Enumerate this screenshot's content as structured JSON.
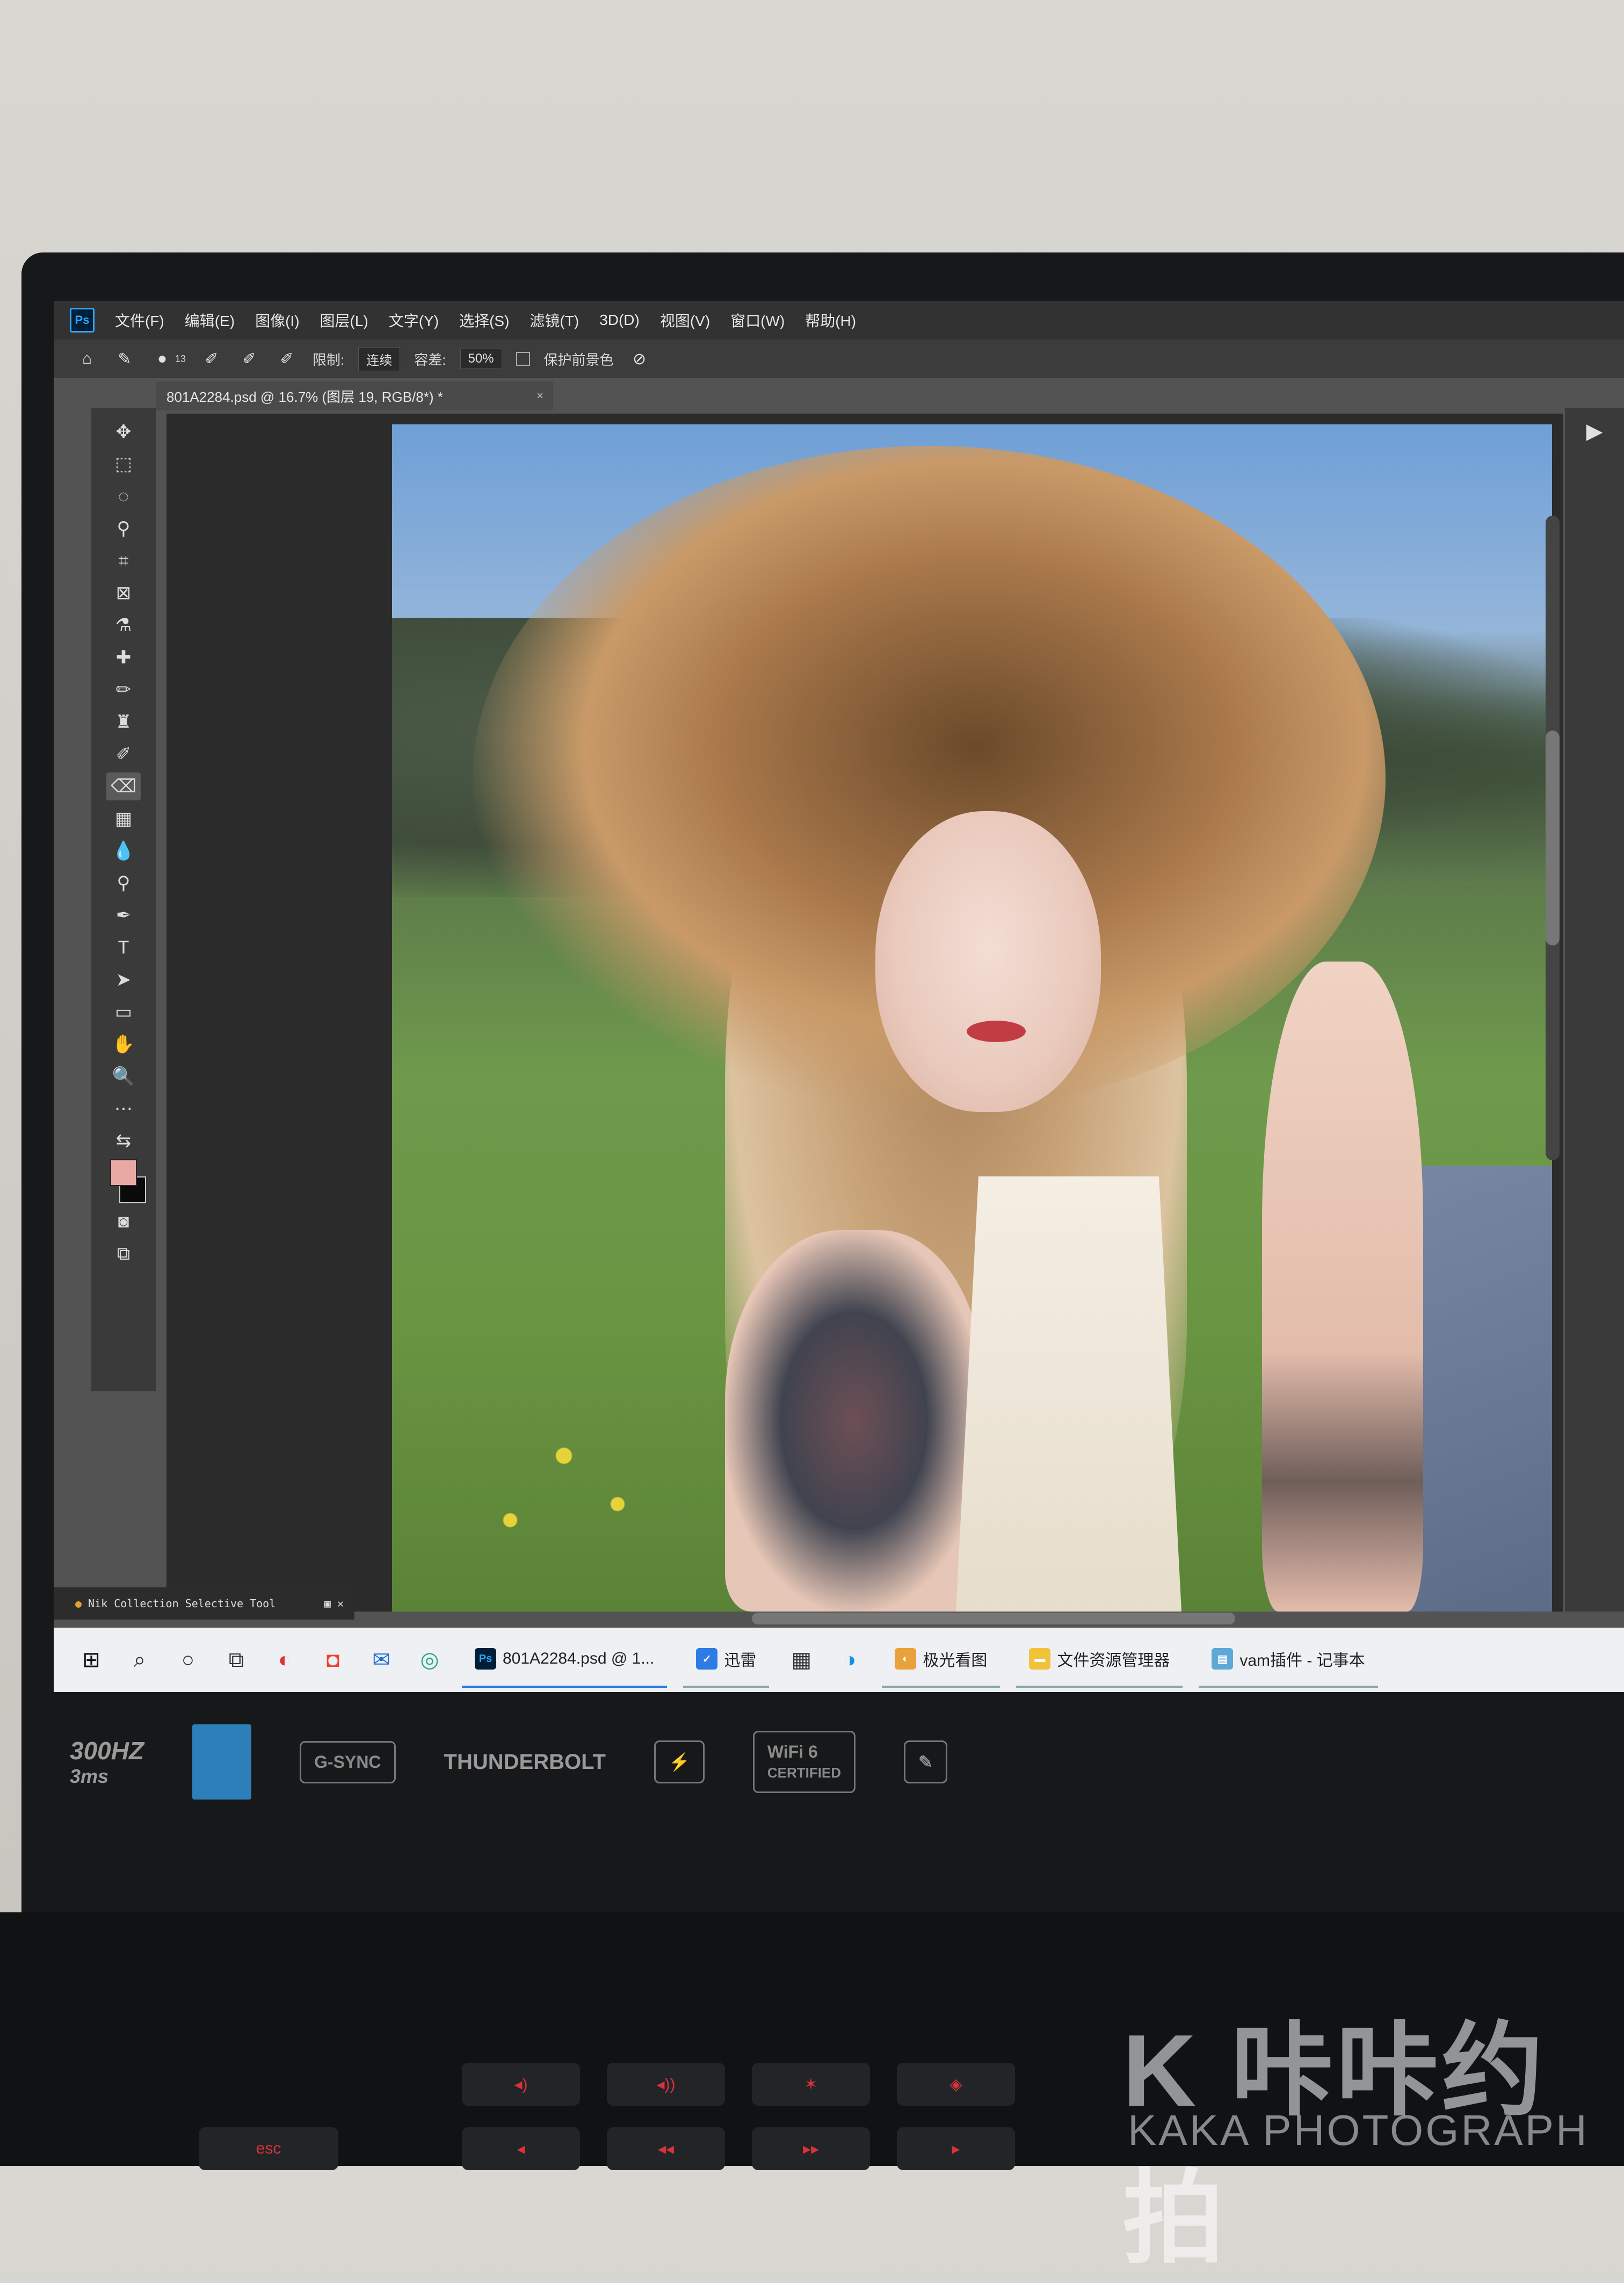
{
  "app": {
    "logo": "Ps"
  },
  "menu": [
    "文件(F)",
    "编辑(E)",
    "图像(I)",
    "图层(L)",
    "文字(Y)",
    "选择(S)",
    "滤镜(T)",
    "3D(D)",
    "视图(V)",
    "窗口(W)",
    "帮助(H)"
  ],
  "options": {
    "brush_size": "13",
    "limit_label": "限制:",
    "limit_value": "连续",
    "tolerance_label": "容差:",
    "tolerance_value": "50%",
    "protect_fg_label": "保护前景色"
  },
  "document": {
    "tab_title": "801A2284.psd @ 16.7% (图层 19, RGB/8*) *",
    "close": "×"
  },
  "panels": {
    "nik_title": "Nik Collection Selective Tool"
  },
  "taskbar": {
    "apps": [
      {
        "badge": "Ps",
        "label": "801A2284.psd @ 1..."
      },
      {
        "label": "迅雷"
      },
      {
        "label": "极光看图"
      },
      {
        "label": "文件资源管理器"
      },
      {
        "label": "vam插件 - 记事本"
      }
    ]
  },
  "stickers": {
    "refresh": "300HZ",
    "response": "3ms",
    "gsync": "G-SYNC",
    "thunderbolt": "THUNDERBOLT",
    "wifi": "WiFi 6",
    "wifi_sub": "CERTIFIED"
  },
  "watermark": {
    "main": "K 咔咔约拍",
    "sub": "KAKA PHOTOGRAPH"
  },
  "colors": {
    "accent": "#31a8ff",
    "foreground_swatch": "#e8a8a4",
    "background_swatch": "#0a0a0a"
  }
}
